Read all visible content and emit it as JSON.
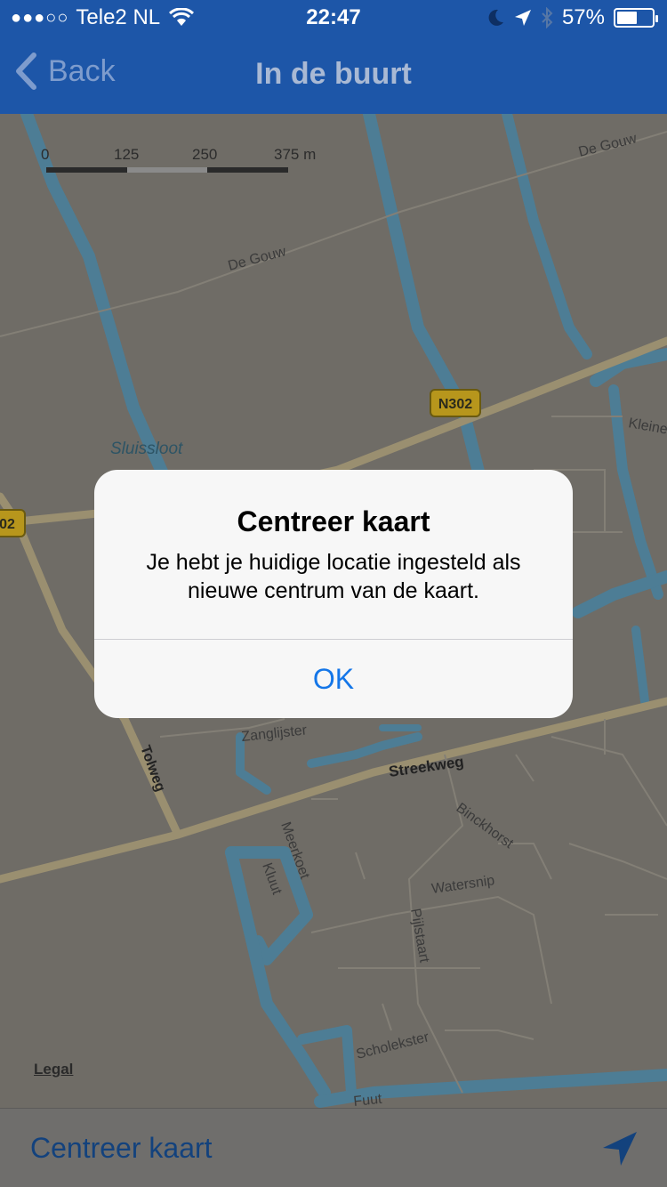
{
  "status_bar": {
    "signal": "●●●○○",
    "carrier": "Tele2 NL",
    "time": "22:47",
    "battery_percent": "57%",
    "battery_level": 0.57
  },
  "nav": {
    "back_label": "Back",
    "title": "In de buurt"
  },
  "map": {
    "scale_labels": [
      "0",
      "125",
      "250",
      "375 m"
    ],
    "street_labels": {
      "de_gouw_1": "De Gouw",
      "de_gouw_2": "De Gouw",
      "n302": "N302",
      "n302_left": "02",
      "sluissloot": "Sluissloot",
      "kleine": "Kleine",
      "zanglijster": "Zanglijster",
      "streekweg": "Streekweg",
      "tolweg": "Tolweg",
      "meerkoet": "Meerkoet",
      "kluut": "Kluut",
      "binckhorst": "Binckhorst",
      "watersnip": "Watersnip",
      "pijlstaart": "Pijlstaart",
      "scholekster": "Scholekster",
      "fuut": "Fuut"
    },
    "legal": "Legal"
  },
  "alert": {
    "title": "Centreer kaart",
    "message": "Je hebt je huidige locatie ingesteld als nieuwe centrum van de kaart.",
    "ok_label": "OK"
  },
  "bottom_bar": {
    "center_label": "Centreer kaart"
  },
  "colors": {
    "nav_bg": "#1d56a8",
    "map_bg": "#6f6c66",
    "water": "#4d7d95",
    "road": "#9a8f70",
    "alert_button": "#1476e8"
  }
}
